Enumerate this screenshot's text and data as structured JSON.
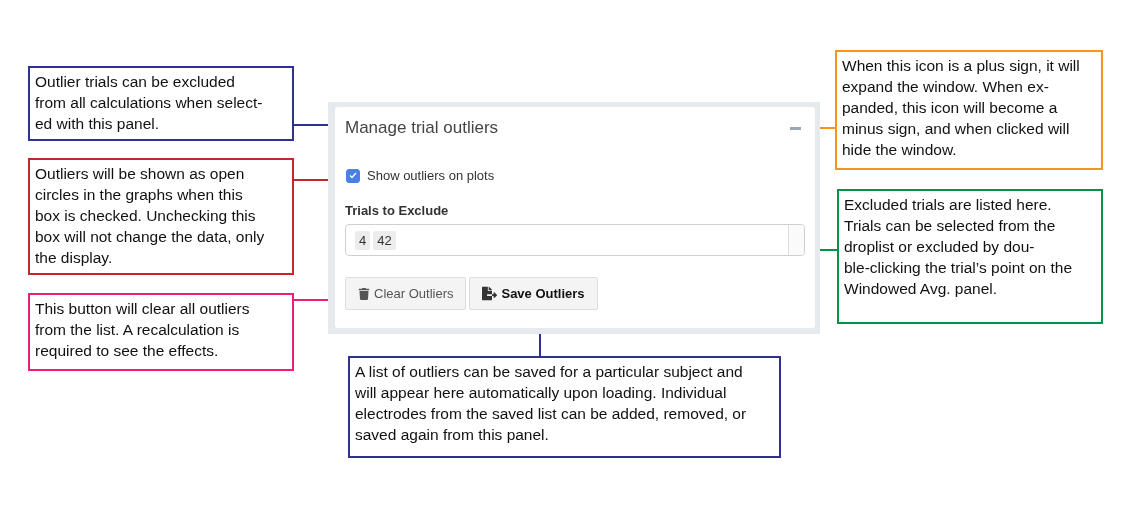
{
  "panel": {
    "title": "Manage trial outliers",
    "checkbox": {
      "label": "Show outliers on plots",
      "checked": true
    },
    "select": {
      "label": "Trials to Exclude",
      "tags": [
        "4",
        "42"
      ]
    },
    "buttons": [
      {
        "label": "Clear Outliers",
        "kind": "clear"
      },
      {
        "label": "Save Outliers",
        "kind": "save"
      }
    ]
  },
  "callouts": [
    {
      "text": "Outlier trials can be excluded\nfrom all calculations when select-\ned with this panel.",
      "color": "#2e3192"
    },
    {
      "text": "Outliers will be shown as open\ncircles in the graphs when this\nbox is checked. Unchecking this\nbox will not change the data, only\nthe display.",
      "color": "#c1272d"
    },
    {
      "text": "This button will clear all outliers\nfrom the list. A recalculation is\nrequired to see the effects.",
      "color": "#ed1e79"
    },
    {
      "text": "When this icon is a plus sign, it will\nexpand the window. When ex-\npanded, this icon will become a\nminus sign, and when clicked will\nhide the window.",
      "color": "#f7931e"
    },
    {
      "text": "Excluded trials are listed here.\nTrials can be selected from the\ndroplist or excluded by dou-\nble-clicking the trial’s point on the\nWindowed Avg. panel.",
      "color": "#009245"
    },
    {
      "text": "A list of outliers can be saved for a particular subject and\nwill appear here automatically upon loading. Individual\nelectrodes from the saved list can be added, removed, or\nsaved again from this panel.",
      "color": "#2e3192"
    }
  ]
}
